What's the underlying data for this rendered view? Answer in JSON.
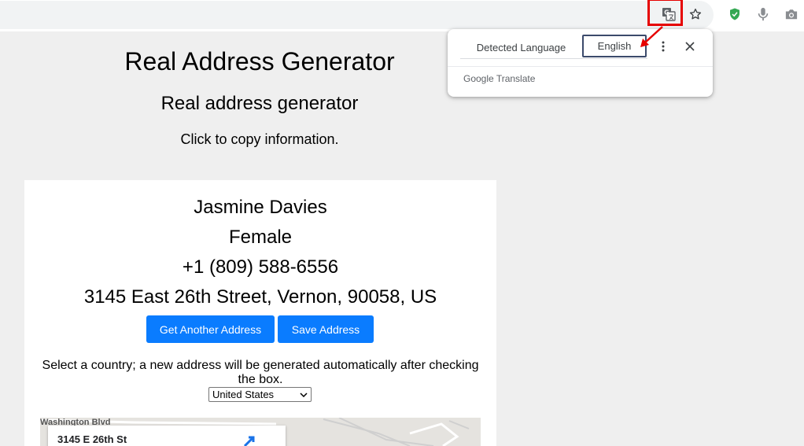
{
  "browser": {
    "icons": [
      "translate-icon",
      "star-icon",
      "shield-icon",
      "mic-icon",
      "camera-icon"
    ],
    "accent_red": "#e60000"
  },
  "translate_popup": {
    "tab_detected": "Detected Language",
    "tab_target": "English",
    "brand": "Google Translate"
  },
  "page": {
    "title": "Real Address Generator",
    "subtitle": "Real address generator",
    "hint": "Click to copy information."
  },
  "person": {
    "name": "Jasmine Davies",
    "gender": "Female",
    "phone": "+1 (809) 588-6556",
    "address": "3145 East 26th Street, Vernon, 90058, US"
  },
  "actions": {
    "another_label": "Get Another Address",
    "save_label": "Save Address",
    "button_color": "#0a7cff"
  },
  "country": {
    "prompt": "Select a country; a new address will be generated automatically after checking the box.",
    "selected": "United States"
  },
  "map": {
    "street_label": "Washington Blvd",
    "card_title": "3145 E 26th St"
  }
}
